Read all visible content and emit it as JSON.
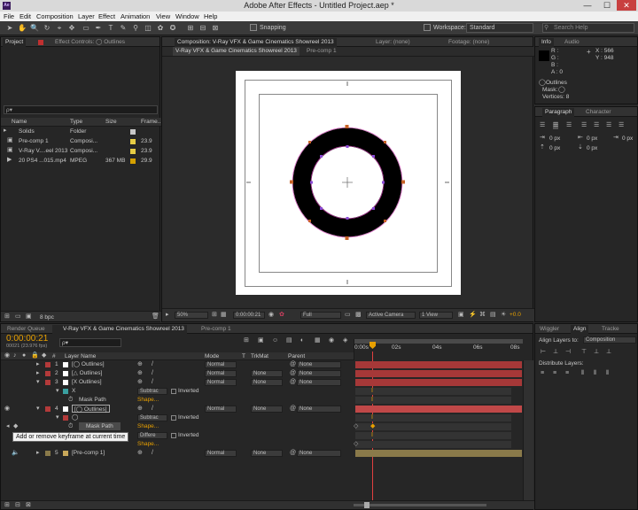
{
  "window": {
    "title": "Adobe After Effects - Untitled Project.aep *",
    "logo": "Ae",
    "min": "—",
    "max": "☐",
    "close": "✕"
  },
  "menu": [
    "File",
    "Edit",
    "Composition",
    "Layer",
    "Effect",
    "Animation",
    "View",
    "Window",
    "Help"
  ],
  "toolbar": {
    "snapping": "Snapping",
    "workspace_label": "Workspace:",
    "workspace_value": "Standard",
    "search_placeholder": "Search Help"
  },
  "project": {
    "tab_project": "Project",
    "tab_effects": "Effect Controls: ◯ Outlines",
    "search_placeholder": "ρ▾",
    "columns": {
      "name": "Name",
      "type": "Type",
      "size": "Size",
      "frame": "Frame..."
    },
    "items": [
      {
        "name": "Solids",
        "type": "Folder",
        "size": "",
        "frame": "",
        "color": "#c8c8c8"
      },
      {
        "name": "Pre-comp 1",
        "type": "Composi...",
        "size": "",
        "frame": "23.9",
        "color": "#e6cc44"
      },
      {
        "name": "V-Ray V....eel 2013",
        "type": "Composi...",
        "size": "",
        "frame": "23.9",
        "color": "#e6cc44"
      },
      {
        "name": "20 PS4 ...015.mp4",
        "type": "MPEG",
        "size": "367 MB",
        "frame": "29.9",
        "color": "#d4a000"
      }
    ],
    "bpc": "8 bpc"
  },
  "comp": {
    "tab": "Composition: V-Ray VFX & Game Cinematics Showreel 2013",
    "layer_tab": "Layer: (none)",
    "footage_tab": "Footage: (none)",
    "breadcrumb1": "V-Ray VFX & Game Cinematics Showreel 2013",
    "breadcrumb2": "Pre-comp 1",
    "zoom": "50%",
    "timecode": "0:00:00:21",
    "resolution": "Full",
    "camera": "Active Camera",
    "view": "1 View",
    "exposure": "+0.0"
  },
  "info": {
    "tab": "Info",
    "audio_tab": "Audio",
    "r": "R :",
    "g": "G :",
    "b": "B :",
    "a": "A : 0",
    "x": "X : 566",
    "y": "Y : 948",
    "layer": "Outlines",
    "mask": "Mask:",
    "vertices": "Vertices: 8"
  },
  "paragraph": {
    "tab": "Paragraph",
    "character_tab": "Character",
    "px": "0 px"
  },
  "timeline": {
    "render_tab": "Render Queue",
    "comp_tab": "V-Ray VFX & Game Cinematics Showreel 2013",
    "precomp_tab": "Pre-comp 1",
    "timecode": "0:00:00:21",
    "fps": "00021 (23.976 fps)",
    "search_placeholder": "ρ▾",
    "columns": {
      "layer_name": "Layer Name",
      "mode": "Mode",
      "t": "T",
      "trkmat": "TrkMat",
      "parent": "Parent"
    },
    "ruler": [
      "0:00s",
      "02s",
      "04s",
      "06s",
      "08s"
    ],
    "tooltip": "Add or remove keyframe at current time",
    "rows": [
      {
        "num": "1",
        "name": "[◯ Outlines]",
        "mode": "Normal",
        "trk": "",
        "parent": "None",
        "label": "#b33a3a"
      },
      {
        "num": "2",
        "name": "[△ Outlines]",
        "mode": "Normal",
        "trk": "None",
        "parent": "None",
        "label": "#b33a3a"
      },
      {
        "num": "3",
        "name": "[X Outlines]",
        "mode": "Normal",
        "trk": "None",
        "parent": "None",
        "label": "#b33a3a"
      },
      {
        "num": "",
        "name": "X",
        "mode": "Subtrac",
        "trk": "Inverted",
        "parent": "",
        "label": "#3aa0a0"
      },
      {
        "num": "",
        "name": "Mask Path",
        "mode": "Shape...",
        "trk": "",
        "parent": "",
        "label": ""
      },
      {
        "num": "4",
        "name": "[◯ Outlines]",
        "mode": "Normal",
        "trk": "None",
        "parent": "None",
        "label": "#b33a3a"
      },
      {
        "num": "",
        "name": "◯",
        "mode": "Subtrac",
        "trk": "Inverted",
        "parent": "",
        "label": ""
      },
      {
        "num": "",
        "name": "Mask Path",
        "mode": "Shape...",
        "trk": "",
        "parent": "",
        "label": ""
      },
      {
        "num": "",
        "name": "",
        "mode": "Differe",
        "trk": "Inverted",
        "parent": "",
        "label": "#b060b0"
      },
      {
        "num": "",
        "name": "",
        "mode": "Shape...",
        "trk": "",
        "parent": "",
        "label": ""
      },
      {
        "num": "5",
        "name": "[Pre-comp 1]",
        "mode": "Normal",
        "trk": "None",
        "parent": "None",
        "label": "#8a7a4a"
      }
    ]
  },
  "right_bottom": {
    "wiggler_tab": "Wiggler",
    "align_tab": "Align",
    "tracker_tab": "Tracke",
    "align_layers": "Align Layers to:",
    "align_target": "Composition",
    "distribute": "Distribute Layers:"
  },
  "colors": {
    "accent": "#e88a00",
    "layer_red": "#b33a3a",
    "playhead": "#e04040",
    "timecode": "#e8a000"
  }
}
